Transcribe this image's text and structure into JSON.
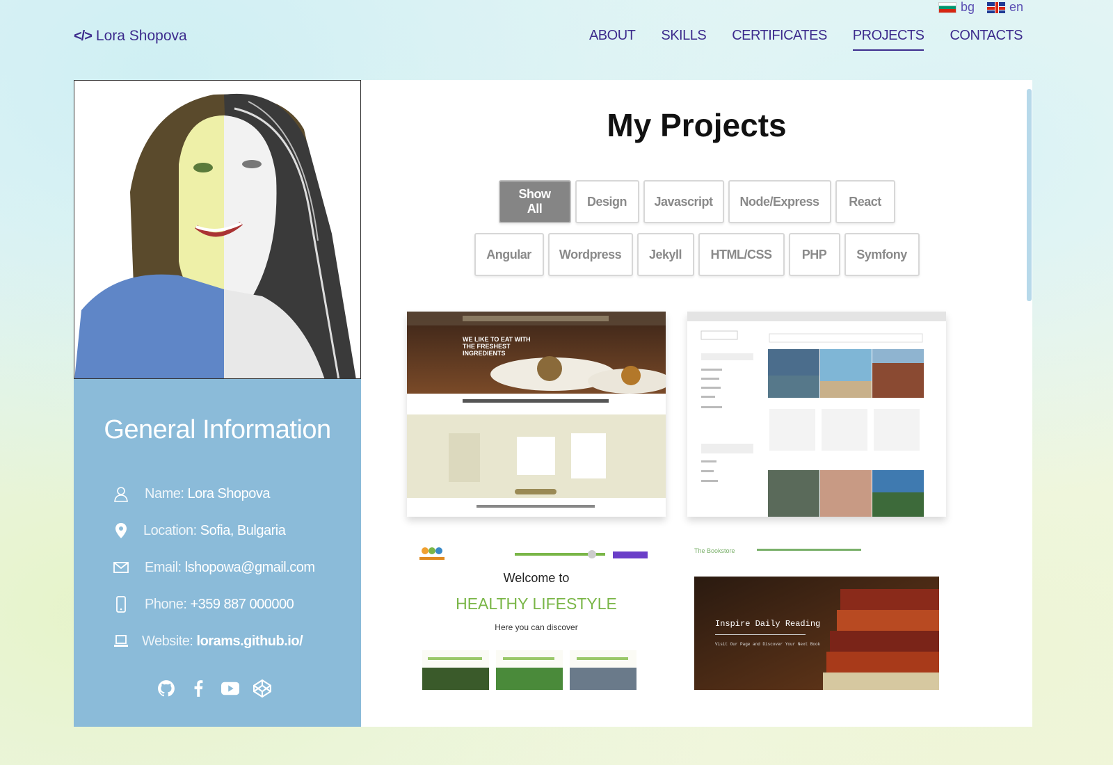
{
  "languages": [
    {
      "code": "bg",
      "flag": "bulgaria-flag"
    },
    {
      "code": "en",
      "flag": "uk-flag"
    }
  ],
  "brand": {
    "icon": "code-icon",
    "name": "Lora Shopova"
  },
  "nav": [
    "ABOUT",
    "SKILLS",
    "CERTIFICATES",
    "PROJECTS",
    "CONTACTS"
  ],
  "nav_active": "PROJECTS",
  "colors": {
    "accent": "#3d2c8d",
    "sidebar": "#8bbbd9",
    "active_filter": "#858585"
  },
  "sidebar": {
    "title": "General Information",
    "items": [
      {
        "icon": "user-icon",
        "label": "Name:",
        "value": "Lora Shopova"
      },
      {
        "icon": "location-pin-icon",
        "label": "Location:",
        "value": "Sofia, Bulgaria"
      },
      {
        "icon": "envelope-icon",
        "label": "Email:",
        "value": "lshopowa@gmail.com"
      },
      {
        "icon": "phone-icon",
        "label": "Phone:",
        "value": "+359 887 000000"
      },
      {
        "icon": "laptop-icon",
        "label": "Website:",
        "value": "lorams.github.io/"
      }
    ],
    "socials": [
      "github-icon",
      "facebook-icon",
      "youtube-icon",
      "codepen-icon"
    ]
  },
  "main": {
    "title": "My Projects",
    "filters_row1": [
      "Show All",
      "Design",
      "Javascript",
      "Node/Express",
      "React"
    ],
    "filters_row2": [
      "Angular",
      "Wordpress",
      "Jekyll",
      "HTML/CSS",
      "PHP",
      "Symfony"
    ],
    "active_filter": "Show All"
  },
  "projects": [
    {
      "name": "restaurant-project",
      "hero_text": "WE LIKE TO EAT WITH THE FRESHEST INGREDIENTS"
    },
    {
      "name": "travel-gallery-project"
    },
    {
      "name": "healthy-lifestyle-project",
      "welcome": "Welcome to",
      "headline": "HEALTHY LIFESTYLE",
      "sub": "Here you can discover"
    },
    {
      "name": "bookstore-project",
      "brand": "The Bookstore",
      "headline": "Inspire Daily Reading",
      "sub": "Visit Our Page and Discover Your Next Book"
    }
  ]
}
